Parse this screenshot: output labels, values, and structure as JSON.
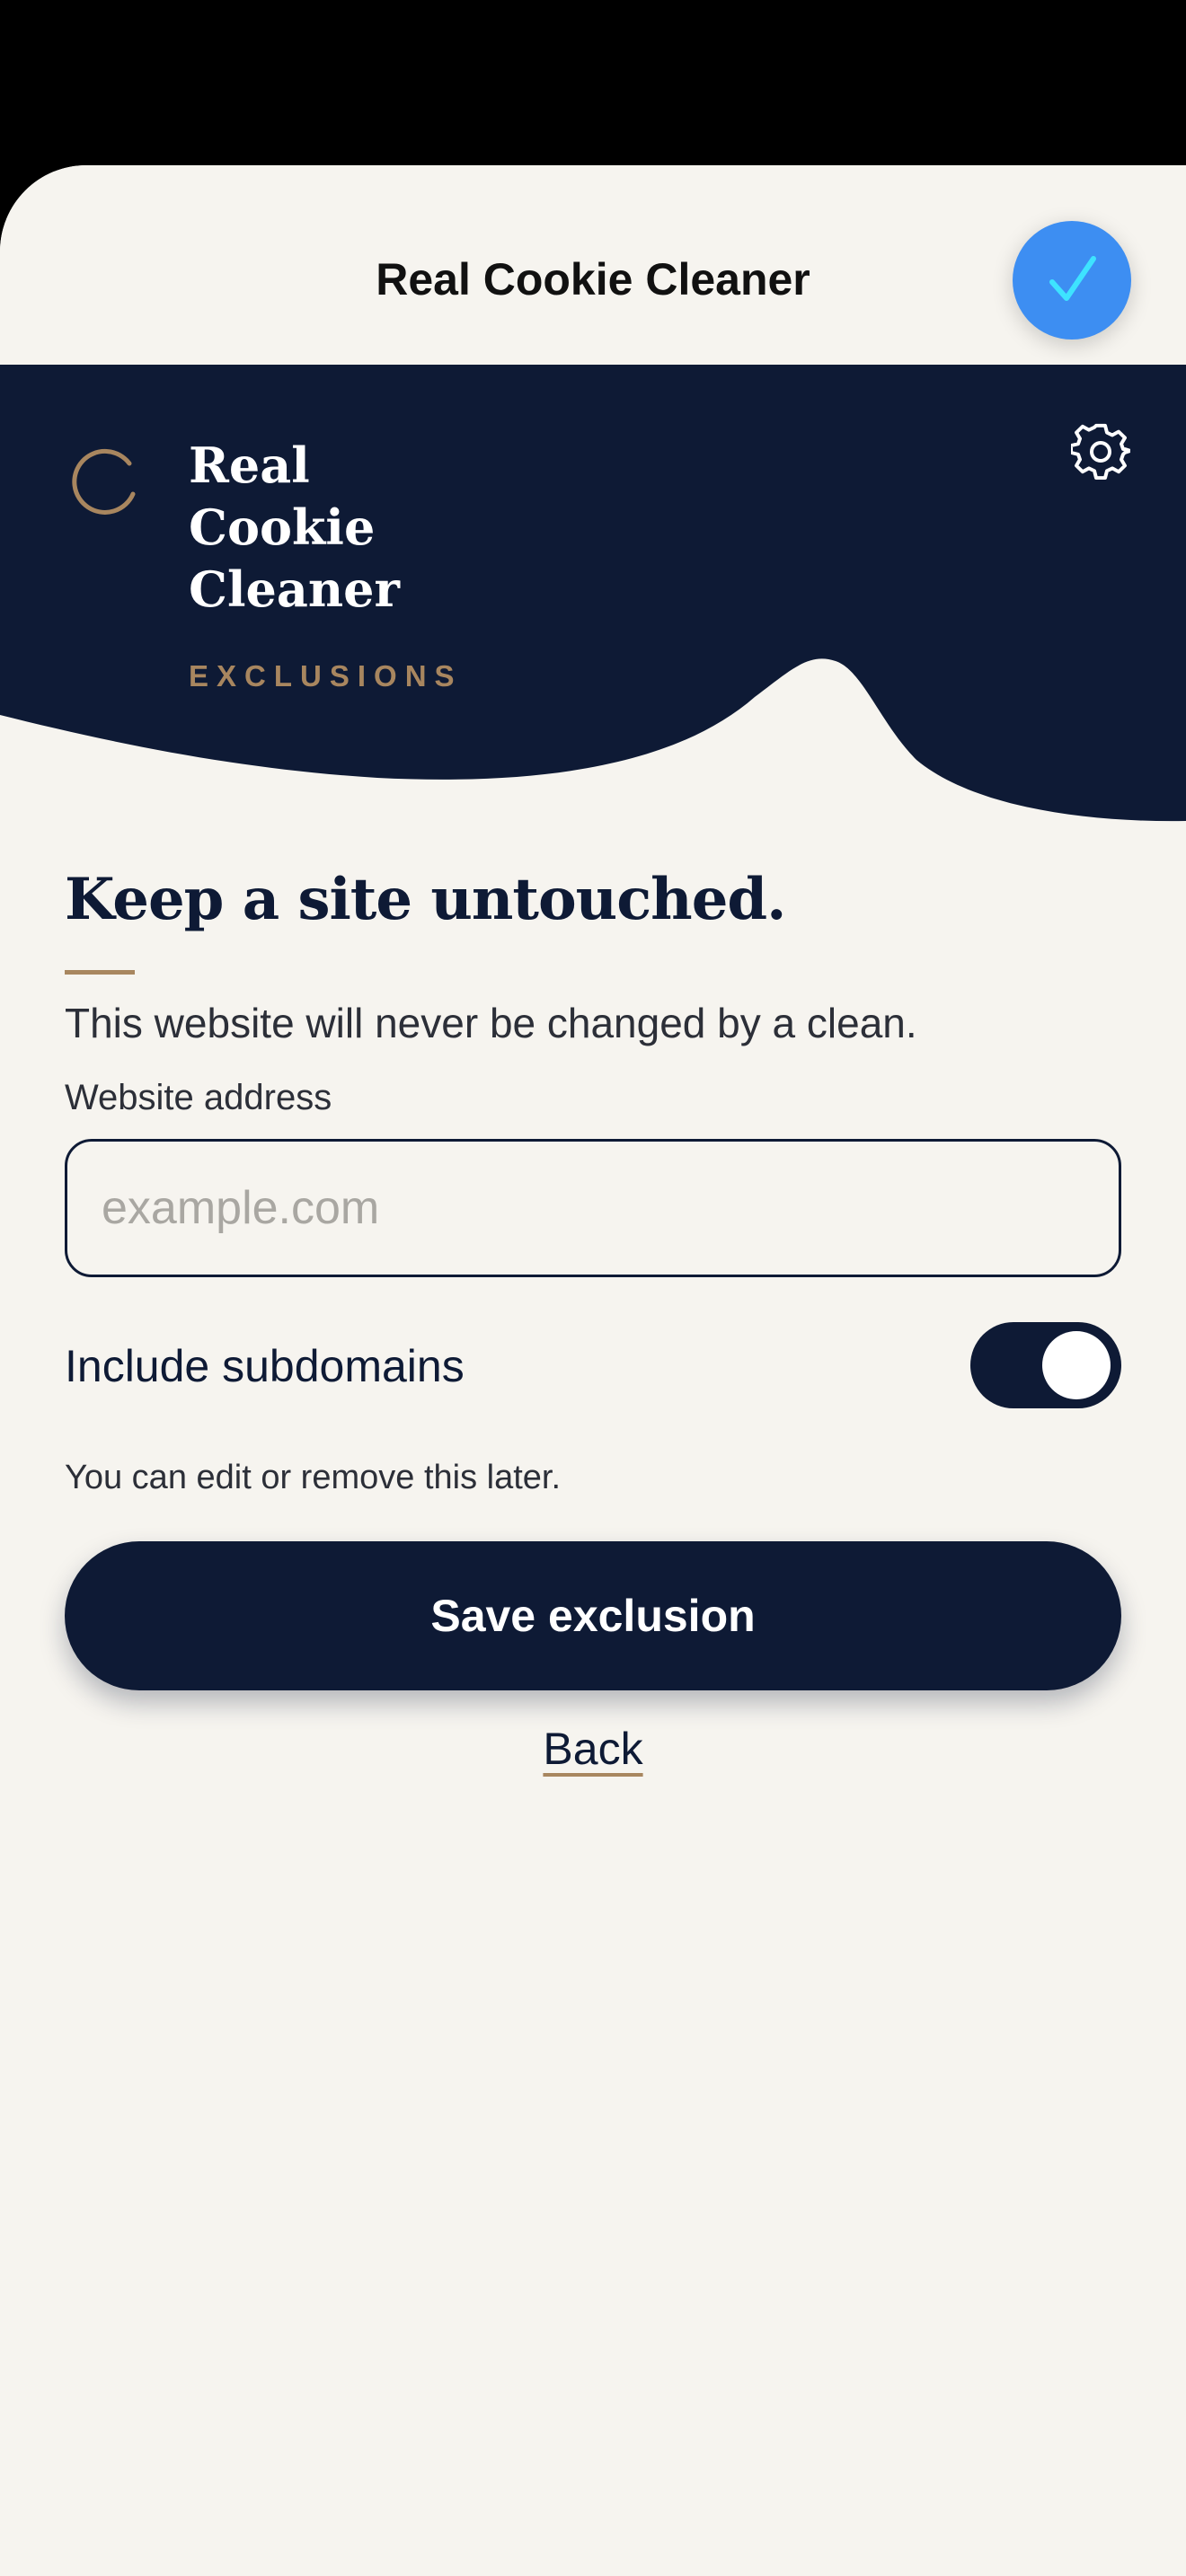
{
  "sheet": {
    "title": "Real Cookie Cleaner",
    "done_icon": "checkmark-icon"
  },
  "brand": {
    "name_lines": [
      "Real",
      "Cookie",
      "Cleaner"
    ],
    "section": "EXCLUSIONS",
    "settings_icon": "gear-icon",
    "loading_icon": "spinner-icon"
  },
  "form": {
    "headline": "Keep a site untouched.",
    "description": "This website will never be changed by a clean.",
    "field_label": "Website address",
    "field_placeholder": "example.com",
    "field_value": "",
    "toggle_label": "Include subdomains",
    "toggle_on": true,
    "hint": "You can edit or remove this later.",
    "save_label": "Save exclusion",
    "back_label": "Back"
  },
  "colors": {
    "navy": "#0e1a35",
    "accent_gold": "#a8865f",
    "done_blue": "#3d8ef2",
    "background": "#f6f4ef"
  }
}
